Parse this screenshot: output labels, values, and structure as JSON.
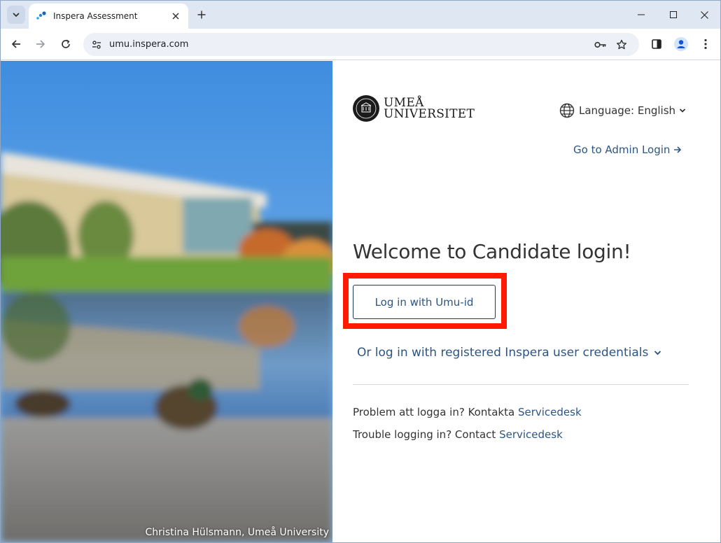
{
  "browser": {
    "tab_title": "Inspera Assessment",
    "url": "umu.inspera.com",
    "accent": "#0b57d0"
  },
  "photo": {
    "credit": "Christina Hülsmann, Umeå University"
  },
  "logo": {
    "line1": "UMEÅ",
    "line2": "UNIVERSITET"
  },
  "language": {
    "label": "Language: English"
  },
  "admin_link": "Go to Admin Login",
  "welcome": "Welcome to Candidate login!",
  "login_button": "Log in with Umu-id",
  "alt_login": "Or log in with registered Inspera user credentials",
  "help": {
    "sv_text": "Problem att logga in? Kontakta",
    "sv_link": "Servicedesk",
    "en_text": "Trouble logging in? Contact",
    "en_link": "Servicedesk"
  },
  "colors": {
    "link": "#2c5582",
    "highlight": "#ff1a00"
  }
}
